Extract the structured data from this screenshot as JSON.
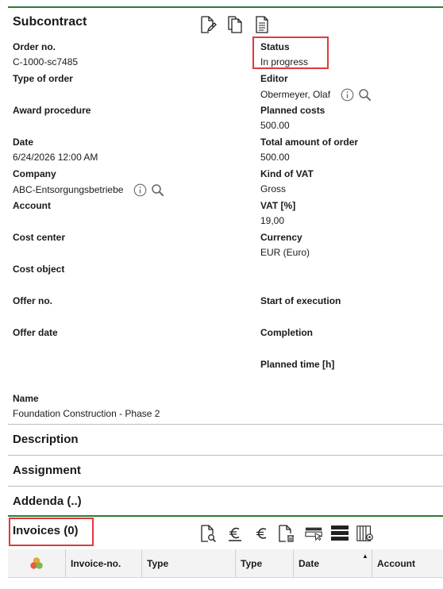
{
  "header": {
    "title": "Subcontract"
  },
  "toolbar": {
    "icons": [
      "edit-document-icon",
      "copy-document-icon",
      "document-text-icon"
    ]
  },
  "fields": {
    "order_no": {
      "label": "Order no.",
      "value": "C-1000-sc7485"
    },
    "status": {
      "label": "Status",
      "value": "In progress"
    },
    "type_of_order": {
      "label": "Type of order",
      "value": ""
    },
    "editor": {
      "label": "Editor",
      "value": "Obermeyer, Olaf"
    },
    "award_procedure": {
      "label": "Award procedure",
      "value": ""
    },
    "planned_costs": {
      "label": "Planned costs",
      "value": "500.00"
    },
    "date": {
      "label": "Date",
      "value": "6/24/2026 12:00 AM"
    },
    "total_amount": {
      "label": "Total amount of order",
      "value": "500.00"
    },
    "company": {
      "label": "Company",
      "value": "ABC-Entsorgungsbetriebe"
    },
    "kind_of_vat": {
      "label": "Kind of VAT",
      "value": "Gross"
    },
    "account": {
      "label": "Account",
      "value": ""
    },
    "vat": {
      "label": "VAT [%]",
      "value": "19,00"
    },
    "cost_center": {
      "label": "Cost center",
      "value": ""
    },
    "currency": {
      "label": "Currency",
      "value": "EUR (Euro)"
    },
    "cost_object": {
      "label": "Cost object",
      "value": ""
    },
    "offer_no": {
      "label": "Offer no.",
      "value": ""
    },
    "start_of_execution": {
      "label": "Start of execution",
      "value": ""
    },
    "offer_date": {
      "label": "Offer date",
      "value": ""
    },
    "completion": {
      "label": "Completion",
      "value": ""
    },
    "planned_time": {
      "label": "Planned time [h]",
      "value": ""
    },
    "name": {
      "label": "Name",
      "value": "Foundation Construction - Phase 2"
    }
  },
  "sections": {
    "description": "Description",
    "assignment": "Assignment",
    "addenda": "Addenda (..)"
  },
  "invoices": {
    "title": "Invoices (0)",
    "toolbar_icons": [
      "search-document-icon",
      "euro-underline-icon",
      "euro-icon",
      "delete-document-icon",
      "select-row-icon",
      "list-view-icon",
      "column-settings-icon"
    ],
    "columns": [
      "Invoice-no.",
      "Type",
      "Type",
      "Date",
      "Account"
    ],
    "sorted_column": "Date",
    "sort_direction": "ascending"
  },
  "colors": {
    "accent_green": "#2e7d32",
    "highlight_red": "#e0393e"
  }
}
